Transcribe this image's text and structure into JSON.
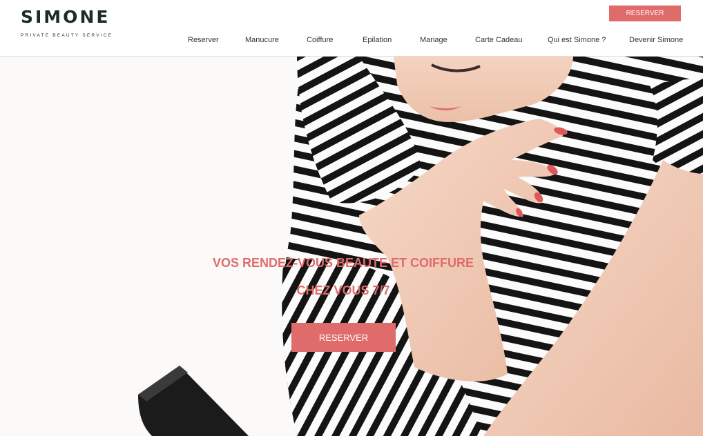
{
  "brand": {
    "name": "SIMONE",
    "tagline": "PRIVATE BEAUTY SERVICE"
  },
  "header": {
    "reserve_label": "RESERVER"
  },
  "nav": {
    "items": [
      {
        "label": "Reserver"
      },
      {
        "label": "Manucure"
      },
      {
        "label": "Coiffure"
      },
      {
        "label": "Epilation"
      },
      {
        "label": "Mariage"
      },
      {
        "label": "Carte Cadeau"
      },
      {
        "label": "Qui est Simone ?"
      },
      {
        "label": "Devenir Simone"
      }
    ]
  },
  "hero": {
    "headline_line1": "VOS RENDEZ-VOUS BEAUTE ET COIFFURE",
    "headline_line2": "CHEZ VOUS 7/7",
    "cta_label": "RESERVER"
  },
  "colors": {
    "accent": "#e06b6b",
    "text": "#333333",
    "logo": "#1f2b2b",
    "background": "#ffffff"
  }
}
